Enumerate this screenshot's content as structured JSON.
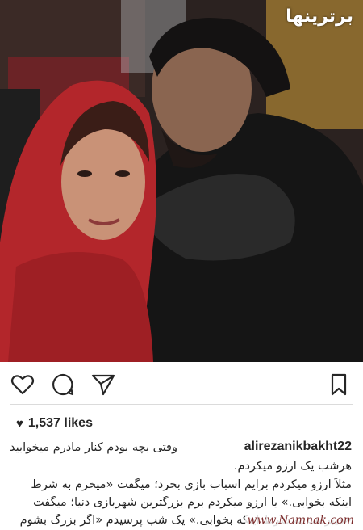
{
  "post": {
    "watermark_top": "برترینها",
    "likes_count": "1,537 likes",
    "username": "alirezanikbakht22",
    "caption_lines": [
      "وقتی بچه بودم کنار مادرم میخوابیدم و",
      "هرشب یک آرزو میکردم.",
      "مثلاً آرزو میکردم برایم اسباب بازی بخرد؛ میگفت «میخرم به شرط",
      "اینکه بخوابی.» یا آرزو میکردم برم بزرگترین شهربازی دنیا؛ میگفت",
      "«میبرمت به شرط اینکه بخوابی.» یک شب پرسیدم «اگر بزرگ بشوم"
    ],
    "watermark_bottom": "www.Namnak.com"
  },
  "icons": {
    "like": "heart-icon",
    "comment": "comment-icon",
    "share": "share-icon",
    "save": "bookmark-icon"
  },
  "colors": {
    "text": "#262626",
    "divider": "#dbdbdb",
    "scarf": "#b3262b"
  }
}
